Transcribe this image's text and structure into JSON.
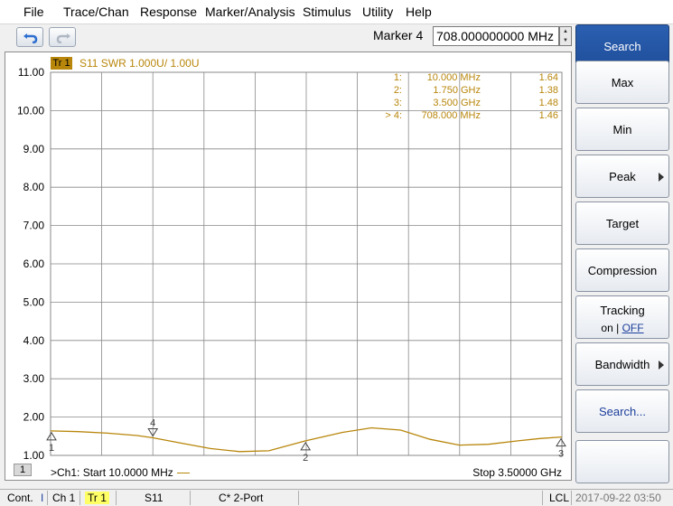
{
  "menu": [
    "File",
    "Trace/Chan",
    "Response",
    "Marker/Analysis",
    "Stimulus",
    "Utility",
    "Help"
  ],
  "toolbar": {
    "marker_label": "Marker 4",
    "marker_value": "708.000000000 MHz"
  },
  "trace": {
    "tag": "Tr 1",
    "info": "S11 SWR 1.000U/ 1.00U"
  },
  "markers": [
    {
      "idx": "1:",
      "freq": "10.000 MHz",
      "val": "1.64"
    },
    {
      "idx": "2:",
      "freq": "1.750 GHz",
      "val": "1.38"
    },
    {
      "idx": "3:",
      "freq": "3.500 GHz",
      "val": "1.48"
    },
    {
      "idx": "> 4:",
      "freq": "708.000 MHz",
      "val": "1.46"
    }
  ],
  "channel": {
    "num": "1",
    "start": ">Ch1:  Start  10.0000 MHz",
    "stop": "Stop  3.50000 GHz"
  },
  "chart_data": {
    "type": "line",
    "xlim": [
      0.01,
      3.5
    ],
    "ylim": [
      1.0,
      11.0
    ],
    "y_ticks": [
      "11.00",
      "10.00",
      "9.00",
      "8.00",
      "7.00",
      "6.00",
      "5.00",
      "4.00",
      "3.00",
      "2.00",
      "1.00"
    ],
    "grid": true,
    "series": [
      {
        "color": "#b8860b",
        "x": [
          0.01,
          0.2,
          0.4,
          0.6,
          0.708,
          0.9,
          1.1,
          1.3,
          1.5,
          1.75,
          2.0,
          2.2,
          2.4,
          2.6,
          2.8,
          3.0,
          3.2,
          3.35,
          3.5
        ],
        "y": [
          1.64,
          1.62,
          1.58,
          1.52,
          1.46,
          1.32,
          1.18,
          1.1,
          1.12,
          1.38,
          1.6,
          1.72,
          1.66,
          1.42,
          1.27,
          1.29,
          1.38,
          1.44,
          1.48
        ]
      }
    ],
    "marker_points": [
      {
        "label": "1",
        "x": 0.01,
        "y": 1.64
      },
      {
        "label": "2",
        "x": 1.75,
        "y": 1.38
      },
      {
        "label": "3",
        "x": 3.5,
        "y": 1.48
      },
      {
        "label": "4",
        "x": 0.708,
        "y": 1.46
      }
    ]
  },
  "softkeys": {
    "search": "Search",
    "max": "Max",
    "min": "Min",
    "peak": "Peak",
    "target": "Target",
    "compression": "Compression",
    "tracking": "Tracking",
    "tracking_on": "on",
    "tracking_sep": " | ",
    "tracking_off": "OFF",
    "bandwidth": "Bandwidth",
    "search_more": "Search..."
  },
  "status": {
    "cont": "Cont.",
    "cont_mark": "I",
    "ch": "Ch 1",
    "tr": "Tr 1",
    "param": "S11",
    "cal": "C* 2-Port",
    "lcl": "LCL",
    "datetime": "2017-09-22 03:50"
  },
  "colors": {
    "trace": "#b8860b",
    "active_key": "#2b5fb0"
  }
}
